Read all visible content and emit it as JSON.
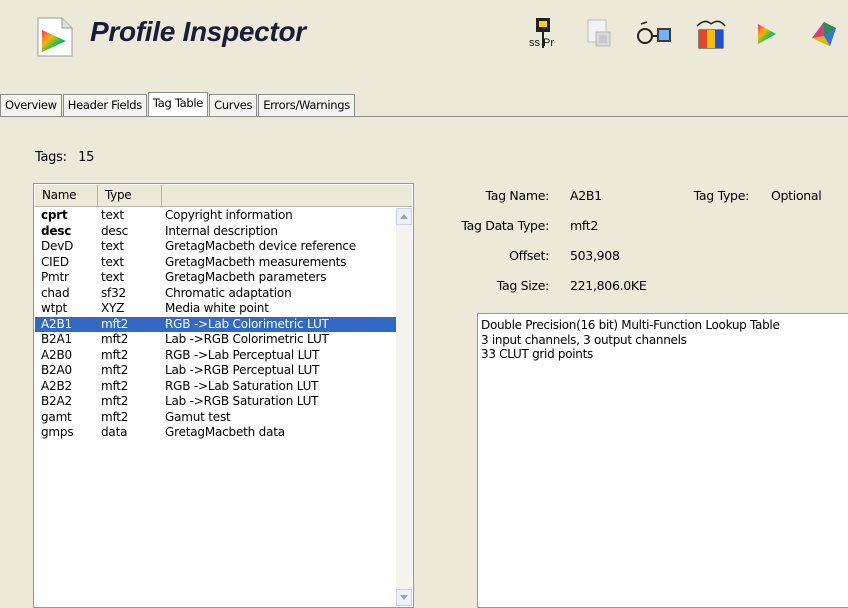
{
  "app": {
    "title": "Profile Inspector"
  },
  "toolbar": {
    "buttons": [
      {
        "name": "ss-pr-icon"
      },
      {
        "name": "embed-icon"
      },
      {
        "name": "glasses-view-icon"
      },
      {
        "name": "compare-icon"
      },
      {
        "name": "play-triangle-icon"
      },
      {
        "name": "gamut-3d-icon"
      }
    ],
    "ss_pr_label": "ss Pr"
  },
  "tabs": [
    {
      "label": "Overview",
      "active": false
    },
    {
      "label": "Header Fields",
      "active": false
    },
    {
      "label": "Tag Table",
      "active": true
    },
    {
      "label": "Curves",
      "active": false
    },
    {
      "label": "Errors/Warnings",
      "active": false
    }
  ],
  "tags": {
    "label": "Tags:",
    "count": "15"
  },
  "list": {
    "columns": [
      "Name",
      "Type"
    ],
    "rows": [
      {
        "name": "cprt",
        "type": "text",
        "desc": "Copyright information",
        "bold": true
      },
      {
        "name": "desc",
        "type": "desc",
        "desc": "Internal description",
        "bold": true
      },
      {
        "name": "DevD",
        "type": "text",
        "desc": "GretagMacbeth device reference",
        "bold": false
      },
      {
        "name": "CIED",
        "type": "text",
        "desc": "GretagMacbeth measurements",
        "bold": false
      },
      {
        "name": "Pmtr",
        "type": "text",
        "desc": "GretagMacbeth parameters",
        "bold": false
      },
      {
        "name": "chad",
        "type": "sf32",
        "desc": "Chromatic adaptation",
        "bold": false
      },
      {
        "name": "wtpt",
        "type": "XYZ",
        "desc": "Media white point",
        "bold": false
      },
      {
        "name": "A2B1",
        "type": "mft2",
        "desc": "RGB ->Lab  Colorimetric LUT",
        "bold": false,
        "selected": true
      },
      {
        "name": "B2A1",
        "type": "mft2",
        "desc": "Lab ->RGB  Colorimetric LUT",
        "bold": false
      },
      {
        "name": "A2B0",
        "type": "mft2",
        "desc": "RGB ->Lab  Perceptual LUT",
        "bold": false
      },
      {
        "name": "B2A0",
        "type": "mft2",
        "desc": "Lab ->RGB  Perceptual LUT",
        "bold": false
      },
      {
        "name": "A2B2",
        "type": "mft2",
        "desc": "RGB ->Lab  Saturation LUT",
        "bold": false
      },
      {
        "name": "B2A2",
        "type": "mft2",
        "desc": "Lab ->RGB  Saturation LUT",
        "bold": false
      },
      {
        "name": "gamt",
        "type": "mft2",
        "desc": "Gamut test",
        "bold": false
      },
      {
        "name": "gmps",
        "type": "data",
        "desc": "GretagMacbeth data",
        "bold": false
      }
    ]
  },
  "details": {
    "tag_name_label": "Tag Name:",
    "tag_name": "A2B1",
    "tag_type_label": "Tag Type:",
    "tag_type": "Optional",
    "data_type_label": "Tag Data Type:",
    "data_type": "mft2",
    "offset_label": "Offset:",
    "offset": "503,908",
    "size_label": "Tag Size:",
    "size": "221,806.0KE",
    "description_lines": [
      "Double Precision(16 bit) Multi-Function Lookup Table",
      "3 input channels, 3 output channels",
      "33 CLUT grid points"
    ]
  },
  "colors": {
    "selection": "#316ac5",
    "panel": "#ece9d8",
    "border": "#7f9db9"
  }
}
